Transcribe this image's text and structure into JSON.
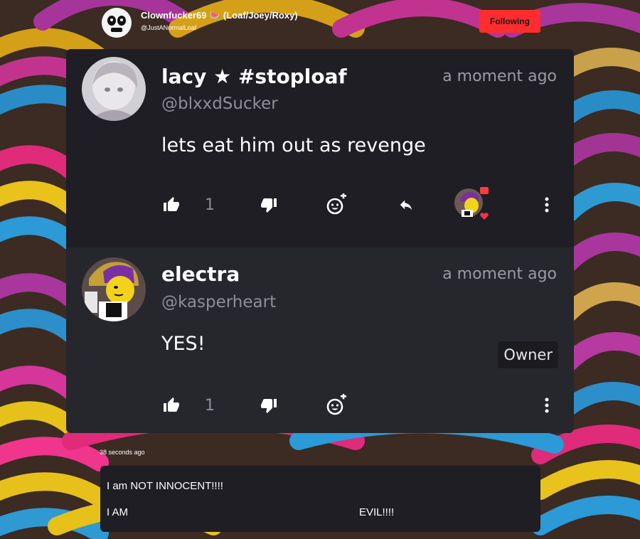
{
  "profile": {
    "name": "Clownfucker69 🍉  (Loaf/Joey/Roxy)",
    "handle": "@JustANormalLoaf",
    "follow_label": "Following"
  },
  "comments": [
    {
      "display_name": "lacy ★ #stoploaf",
      "handle": "@blxxdSucker",
      "time": "a moment ago",
      "text": "lets eat him out as revenge",
      "likes": "1"
    },
    {
      "display_name": "electra",
      "handle": "@kasperheart",
      "time": "a moment ago",
      "badge": "Owner",
      "text": "YES!",
      "likes": "1"
    }
  ],
  "post": {
    "time": "38 seconds ago",
    "line1": "I am NOT INNOCENT!!!!",
    "line2a": "I AM",
    "line2b": "EVIL!!!!"
  },
  "icons": {
    "like": "thumbs-up-icon",
    "dislike": "thumbs-down-icon",
    "react": "add-reaction-icon",
    "reply": "reply-icon",
    "more": "more-vertical-icon",
    "heart": "heart-icon"
  },
  "colors": {
    "accent_red": "#ff2d2d",
    "card_bg": "#1e1e24",
    "card_bg_alt": "#26262d",
    "muted_text": "#8e8e96"
  }
}
